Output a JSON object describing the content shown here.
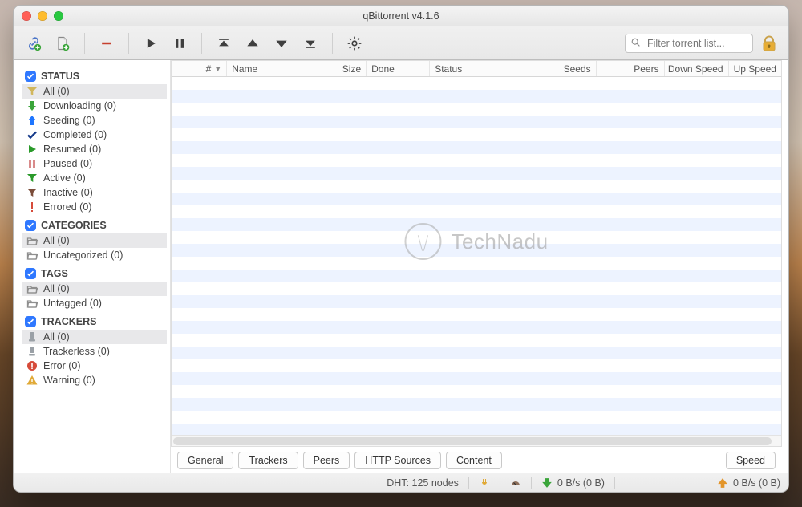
{
  "window": {
    "title": "qBittorrent v4.1.6"
  },
  "toolbar": {
    "search_placeholder": "Filter torrent list..."
  },
  "sidebar": {
    "sections": {
      "status": {
        "title": "STATUS",
        "items": [
          {
            "key": "all",
            "label": "All (0)",
            "icon": "funnel-icon",
            "color": "#d1b65c",
            "selected": true
          },
          {
            "key": "downloading",
            "label": "Downloading (0)",
            "icon": "arrow-down-icon",
            "color": "#3aa53a"
          },
          {
            "key": "seeding",
            "label": "Seeding (0)",
            "icon": "arrow-up-icon",
            "color": "#1e76ff"
          },
          {
            "key": "completed",
            "label": "Completed (0)",
            "icon": "check-icon",
            "color": "#153a8a"
          },
          {
            "key": "resumed",
            "label": "Resumed (0)",
            "icon": "play-icon",
            "color": "#2a9a2a"
          },
          {
            "key": "paused",
            "label": "Paused (0)",
            "icon": "pause-icon",
            "color": "#d98b8b"
          },
          {
            "key": "active",
            "label": "Active (0)",
            "icon": "funnel-icon",
            "color": "#2a9a2a"
          },
          {
            "key": "inactive",
            "label": "Inactive (0)",
            "icon": "funnel-icon",
            "color": "#7b4d3a"
          },
          {
            "key": "errored",
            "label": "Errored (0)",
            "icon": "alert-icon",
            "color": "#d64b3a"
          }
        ]
      },
      "categories": {
        "title": "CATEGORIES",
        "items": [
          {
            "key": "all",
            "label": "All (0)",
            "icon": "folder-open-icon",
            "color": "#8e8e8e",
            "selected": true
          },
          {
            "key": "uncategorized",
            "label": "Uncategorized (0)",
            "icon": "folder-open-icon",
            "color": "#8e8e8e"
          }
        ]
      },
      "tags": {
        "title": "TAGS",
        "items": [
          {
            "key": "all",
            "label": "All (0)",
            "icon": "folder-open-icon",
            "color": "#8e8e8e",
            "selected": true
          },
          {
            "key": "untagged",
            "label": "Untagged (0)",
            "icon": "folder-open-icon",
            "color": "#8e8e8e"
          }
        ]
      },
      "trackers": {
        "title": "TRACKERS",
        "items": [
          {
            "key": "all",
            "label": "All (0)",
            "icon": "server-icon",
            "color": "#9aa0a6",
            "selected": true
          },
          {
            "key": "trackerless",
            "label": "Trackerless (0)",
            "icon": "server-icon",
            "color": "#9aa0a6"
          },
          {
            "key": "error",
            "label": "Error (0)",
            "icon": "error-circle-icon",
            "color": "#d64b3a"
          },
          {
            "key": "warning",
            "label": "Warning (0)",
            "icon": "warning-icon",
            "color": "#e0a936"
          }
        ]
      }
    }
  },
  "columns": {
    "num": "#",
    "name": "Name",
    "size": "Size",
    "done": "Done",
    "status": "Status",
    "seeds": "Seeds",
    "peers": "Peers",
    "down": "Down Speed",
    "up": "Up Speed"
  },
  "watermark": "TechNadu",
  "tabs": {
    "general": "General",
    "trackers": "Trackers",
    "peers": "Peers",
    "http": "HTTP Sources",
    "content": "Content",
    "speed": "Speed"
  },
  "statusbar": {
    "dht": "DHT: 125 nodes",
    "down": "0 B/s (0 B)",
    "up": "0 B/s (0 B)"
  }
}
